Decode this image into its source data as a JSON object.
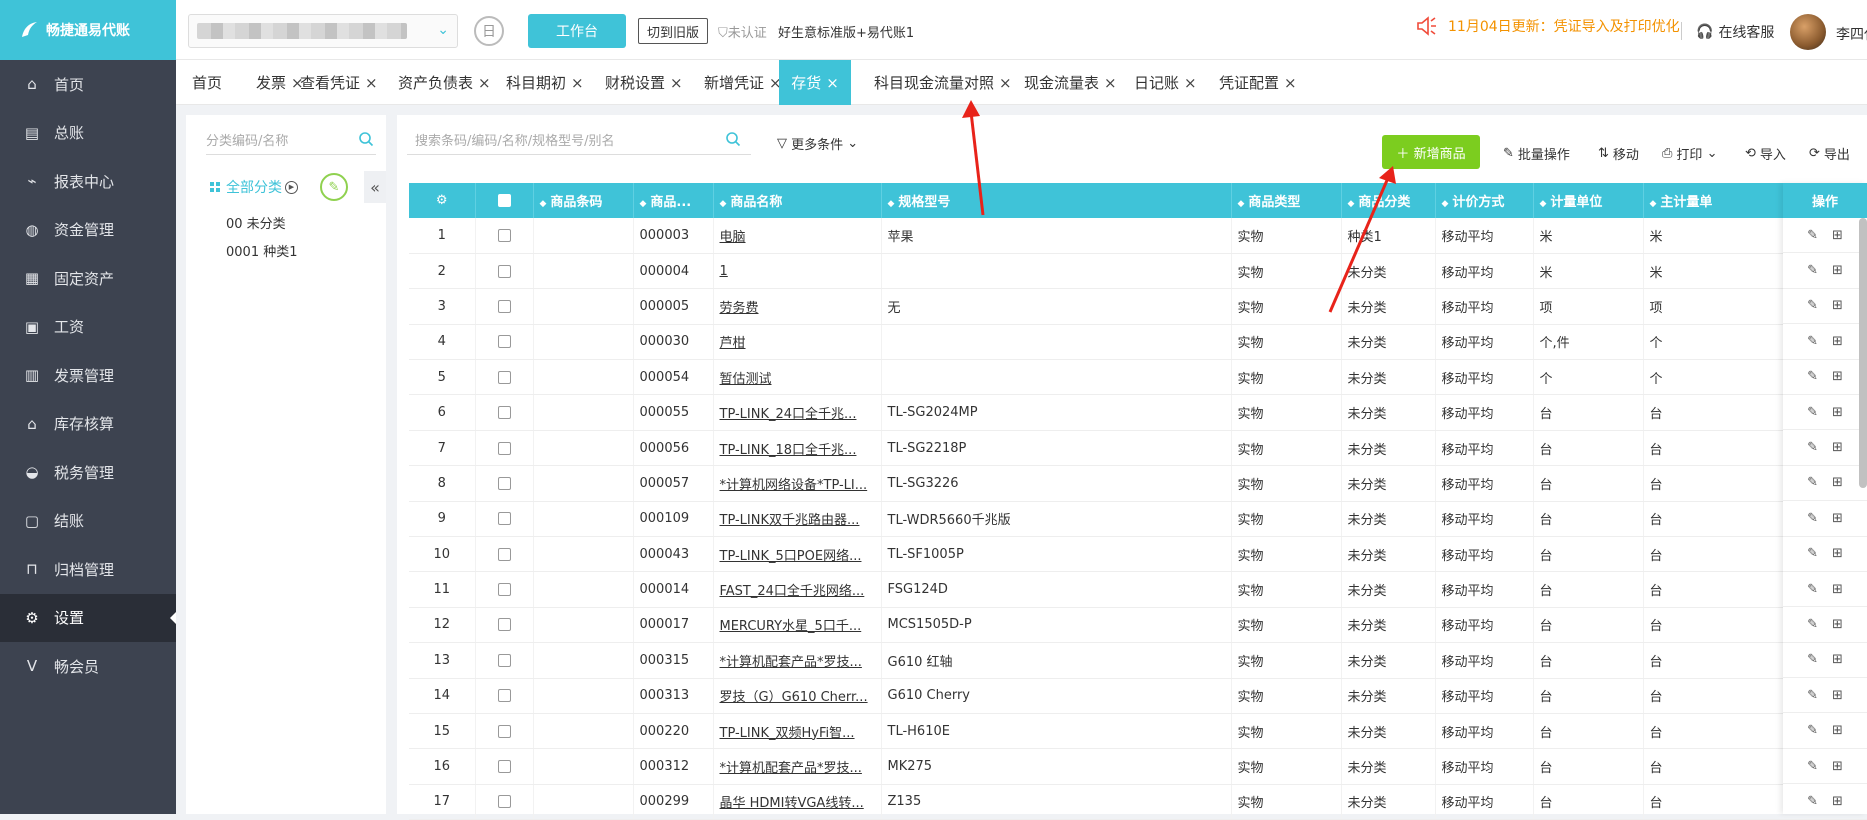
{
  "app": {
    "logo_text": "畅捷通易代账",
    "company_placeholder": "",
    "work_button": "工作台",
    "old_version_button": "切到旧版",
    "cert_status": "未认证",
    "edition": "好生意标准版+易代账1",
    "notice": "11月04日更新：凭证导入及打印优化",
    "service": "在线客服",
    "user_name": "李四代"
  },
  "sidebar": {
    "items": [
      {
        "label": "首页",
        "icon": "home-icon"
      },
      {
        "label": "总账",
        "icon": "ledger-icon"
      },
      {
        "label": "报表中心",
        "icon": "chart-icon"
      },
      {
        "label": "资金管理",
        "icon": "money-bag-icon"
      },
      {
        "label": "固定资产",
        "icon": "building-icon"
      },
      {
        "label": "工资",
        "icon": "salary-icon"
      },
      {
        "label": "发票管理",
        "icon": "invoice-icon"
      },
      {
        "label": "库存核算",
        "icon": "warehouse-icon"
      },
      {
        "label": "税务管理",
        "icon": "tax-icon"
      },
      {
        "label": "结账",
        "icon": "checkout-icon"
      },
      {
        "label": "归档管理",
        "icon": "archive-icon"
      },
      {
        "label": "设置",
        "icon": "gear-icon"
      },
      {
        "label": "畅会员",
        "icon": "member-icon"
      }
    ]
  },
  "tabs": [
    {
      "label": "首页"
    },
    {
      "label": "发票"
    },
    {
      "label": "查看凭证"
    },
    {
      "label": "资产负债表"
    },
    {
      "label": "科目期初"
    },
    {
      "label": "财税设置"
    },
    {
      "label": "新增凭证"
    },
    {
      "label": "存货"
    },
    {
      "label": "科目现金流量对照"
    },
    {
      "label": "现金流量表"
    },
    {
      "label": "日记账"
    },
    {
      "label": "凭证配置"
    }
  ],
  "category": {
    "search_placeholder": "分类编码/名称",
    "all_label": "全部分类",
    "items": [
      "00 未分类",
      "0001 种类1"
    ]
  },
  "toolbar": {
    "search_placeholder": "搜索条码/编码/名称/规格型号/别名",
    "more_conditions": "更多条件",
    "add_button": "新增商品",
    "batch": "批量操作",
    "move": "移动",
    "print": "打印",
    "import": "导入",
    "export": "导出"
  },
  "table": {
    "headers": [
      "商品条码",
      "商品...",
      "商品名称",
      "规格型号",
      "商品类型",
      "商品分类",
      "计价方式",
      "计量单位",
      "主计量单"
    ],
    "op_header": "操作",
    "rows": [
      [
        "1",
        "",
        "000003",
        "电脑",
        "苹果",
        "实物",
        "种类1",
        "移动平均",
        "米",
        "米"
      ],
      [
        "2",
        "",
        "000004",
        "1",
        "",
        "实物",
        "未分类",
        "移动平均",
        "米",
        "米"
      ],
      [
        "3",
        "",
        "000005",
        "劳务费",
        "无",
        "实物",
        "未分类",
        "移动平均",
        "项",
        "项"
      ],
      [
        "4",
        "",
        "000030",
        "芦柑",
        "",
        "实物",
        "未分类",
        "移动平均",
        "个,件",
        "个"
      ],
      [
        "5",
        "",
        "000054",
        "暂估测试",
        "",
        "实物",
        "未分类",
        "移动平均",
        "个",
        "个"
      ],
      [
        "6",
        "",
        "000055",
        "TP-LINK_24口全千兆...",
        "TL-SG2024MP",
        "实物",
        "未分类",
        "移动平均",
        "台",
        "台"
      ],
      [
        "7",
        "",
        "000056",
        "TP-LINK_18口全千兆...",
        "TL-SG2218P",
        "实物",
        "未分类",
        "移动平均",
        "台",
        "台"
      ],
      [
        "8",
        "",
        "000057",
        "*计算机网络设备*TP-LI...",
        "TL-SG3226",
        "实物",
        "未分类",
        "移动平均",
        "台",
        "台"
      ],
      [
        "9",
        "",
        "000109",
        "TP-LINK双千兆路由器...",
        "TL-WDR5660千兆版",
        "实物",
        "未分类",
        "移动平均",
        "台",
        "台"
      ],
      [
        "10",
        "",
        "000043",
        "TP-LINK_5口POE网络...",
        "TL-SF1005P",
        "实物",
        "未分类",
        "移动平均",
        "台",
        "台"
      ],
      [
        "11",
        "",
        "000014",
        "FAST_24口全千兆网络...",
        "FSG124D",
        "实物",
        "未分类",
        "移动平均",
        "台",
        "台"
      ],
      [
        "12",
        "",
        "000017",
        "MERCURY水星_5口千...",
        "MCS1505D-P",
        "实物",
        "未分类",
        "移动平均",
        "台",
        "台"
      ],
      [
        "13",
        "",
        "000315",
        "*计算机配套产品*罗技...",
        "G610 红轴",
        "实物",
        "未分类",
        "移动平均",
        "台",
        "台"
      ],
      [
        "14",
        "",
        "000313",
        "罗技（G）G610 Cherr...",
        "G610 Cherry",
        "实物",
        "未分类",
        "移动平均",
        "台",
        "台"
      ],
      [
        "15",
        "",
        "000220",
        "TP-LINK_双频HyFi智...",
        "TL-H610E",
        "实物",
        "未分类",
        "移动平均",
        "台",
        "台"
      ],
      [
        "16",
        "",
        "000312",
        "*计算机配套产品*罗技...",
        "MK275",
        "实物",
        "未分类",
        "移动平均",
        "台",
        "台"
      ],
      [
        "17",
        "",
        "000299",
        "晶华 HDMI转VGA线转...",
        "Z135",
        "实物",
        "未分类",
        "移动平均",
        "台",
        "台"
      ]
    ]
  },
  "colors": {
    "accent": "#3fc3d8",
    "add_green": "#7ccd1f",
    "sidebar_bg": "#3d4350",
    "notice": "#f39200",
    "annotation": "#e8231a"
  }
}
